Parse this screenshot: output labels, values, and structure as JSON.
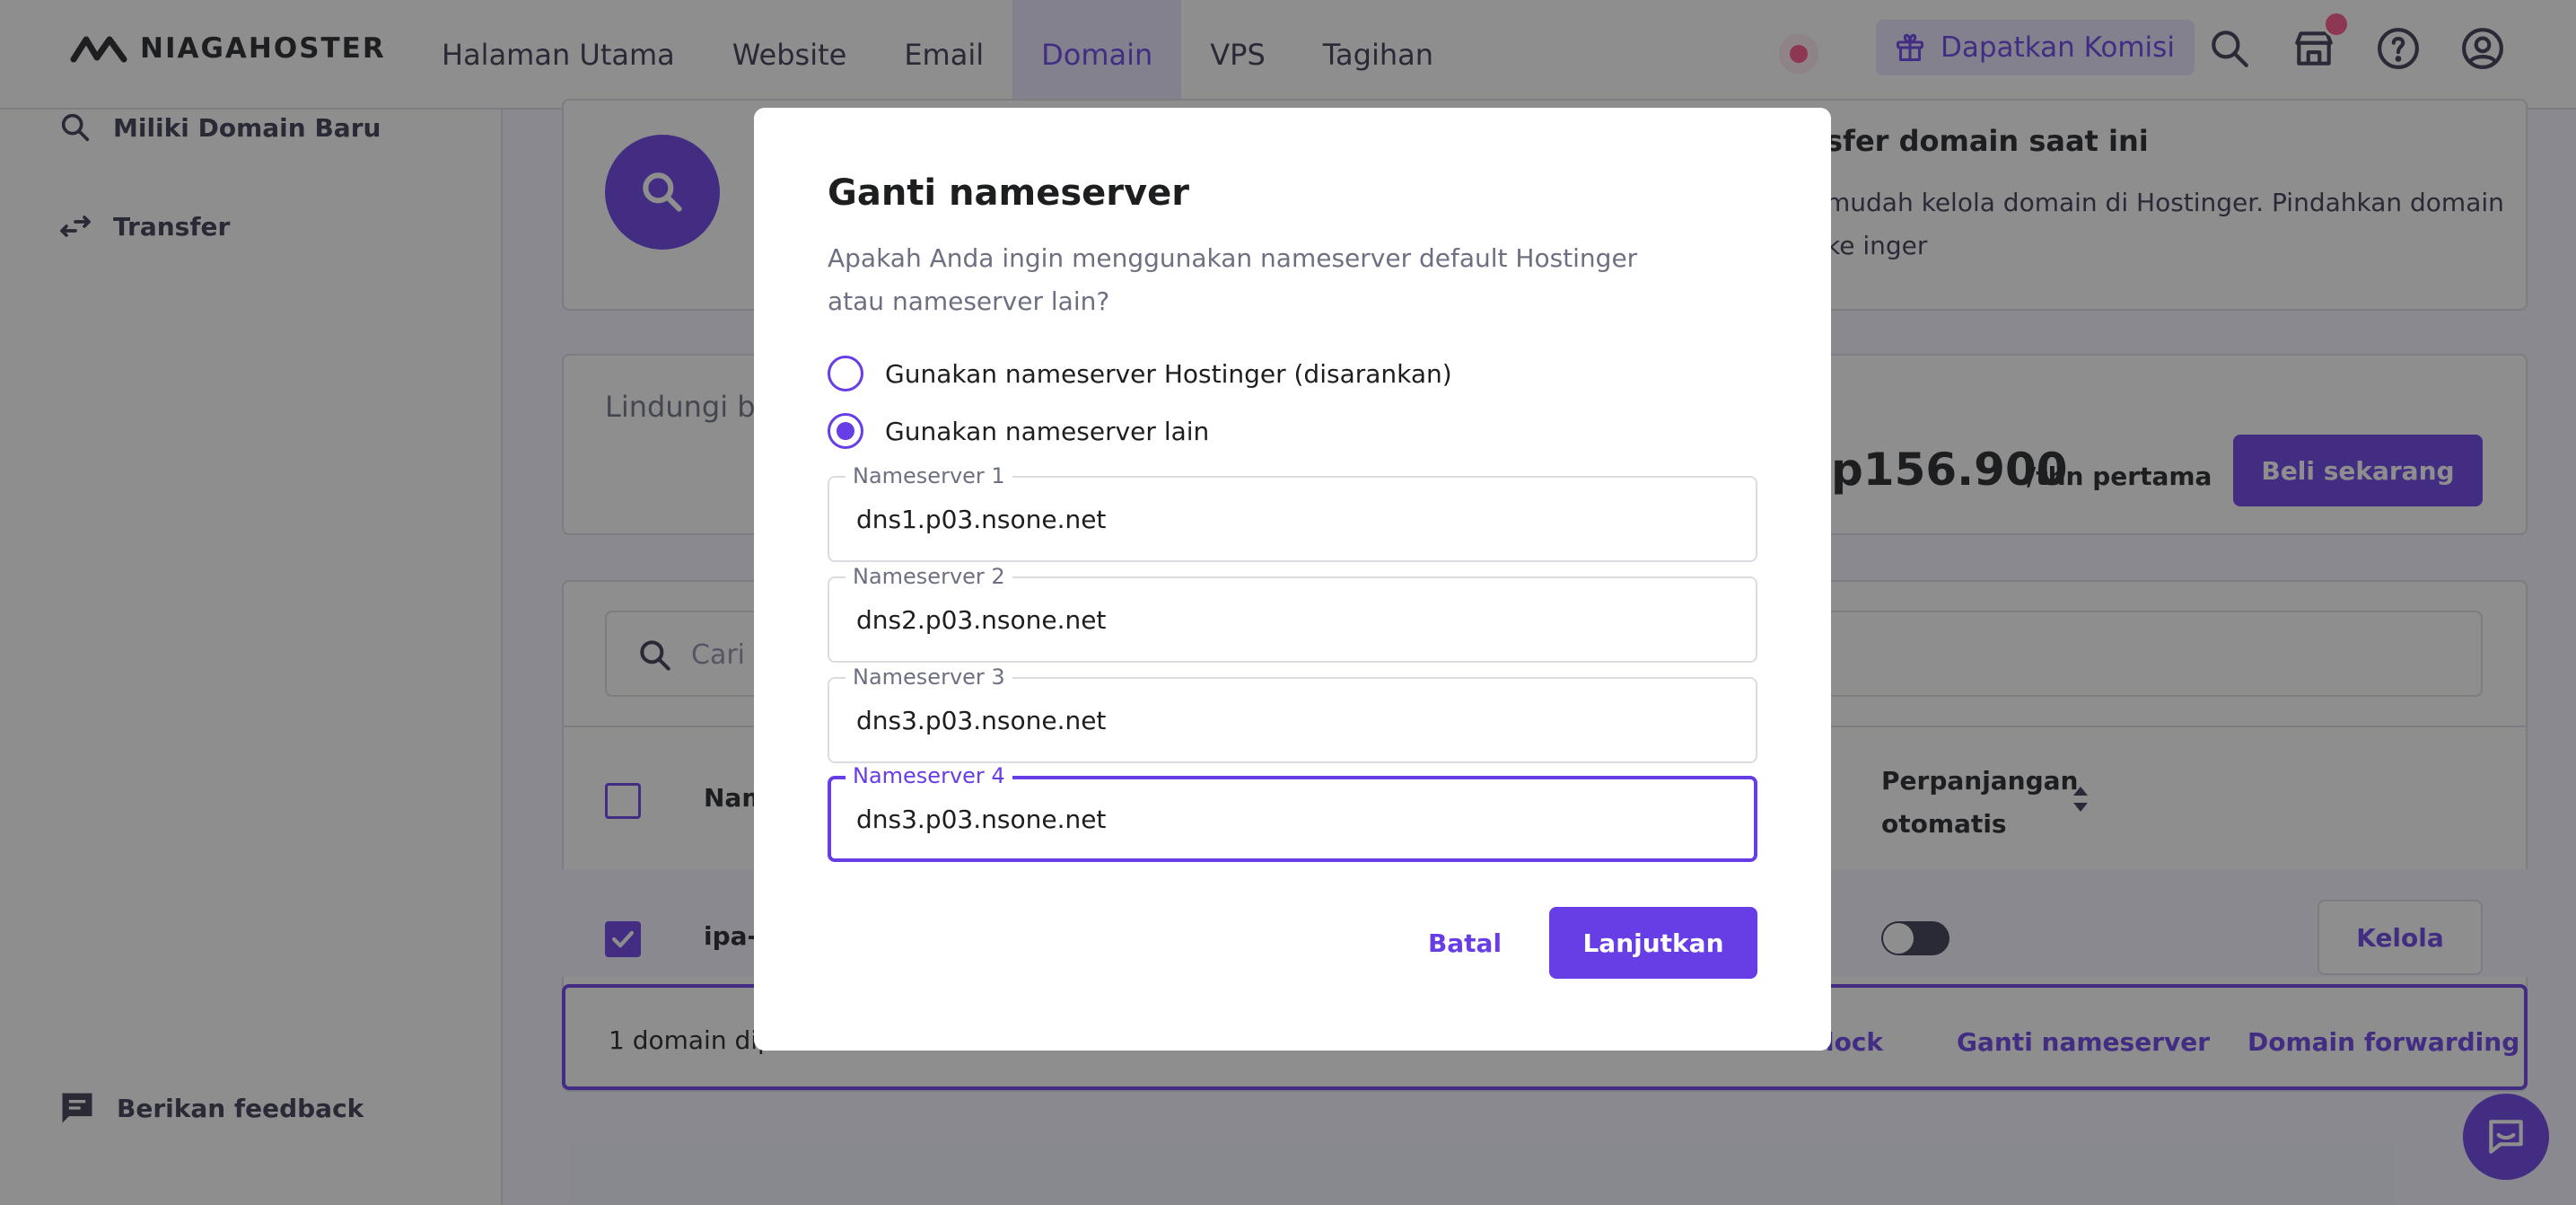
{
  "header": {
    "brand": "NIAGAHOSTER",
    "nav": [
      {
        "label": "Halaman Utama"
      },
      {
        "label": "Website"
      },
      {
        "label": "Email"
      },
      {
        "label": "Domain",
        "active": true
      },
      {
        "label": "VPS"
      },
      {
        "label": "Tagihan"
      }
    ],
    "commission_label": "Dapatkan Komisi",
    "icons": [
      "search-icon",
      "store-icon",
      "help-icon",
      "account-icon"
    ]
  },
  "sidebar": {
    "items": [
      {
        "label": "Miliki Domain Baru",
        "icon": "search-icon"
      },
      {
        "label": "Transfer",
        "icon": "transfer-icon"
      }
    ],
    "feedback_label": "Berikan feedback"
  },
  "main": {
    "promo": {
      "title_visible": "sfer domain saat ini",
      "text_visible": "mudah kelola domain di Hostinger. Pindahkan domain ke inger"
    },
    "protect": {
      "text_visible": "Lindungi br",
      "price_visible": "p156.900",
      "price_suffix": "/thn pertama",
      "buy_label": "Beli sekarang"
    },
    "search_placeholder": "Cari",
    "table": {
      "col_name_visible": "Nam",
      "col_renew": "Perpanjangan otomatis",
      "row_domain_visible": "ipa-",
      "manage_label": "Kelola"
    },
    "action_bar": {
      "count_visible": "1 domain dipi",
      "links": [
        {
          "label": "lock"
        },
        {
          "label": "Ganti nameserver"
        },
        {
          "label": "Domain forwarding"
        }
      ]
    }
  },
  "modal": {
    "title": "Ganti nameserver",
    "description": "Apakah Anda ingin menggunakan nameserver default Hostinger atau nameserver lain?",
    "options": [
      {
        "label": "Gunakan nameserver Hostinger (disarankan)",
        "selected": false
      },
      {
        "label": "Gunakan nameserver lain",
        "selected": true
      }
    ],
    "nameservers": [
      {
        "label": "Nameserver 1",
        "value": "dns1.p03.nsone.net"
      },
      {
        "label": "Nameserver 2",
        "value": "dns2.p03.nsone.net"
      },
      {
        "label": "Nameserver 3",
        "value": "dns3.p03.nsone.net"
      },
      {
        "label": "Nameserver 4",
        "value": "dns3.p03.nsone.net",
        "focused": true
      }
    ],
    "cancel_label": "Batal",
    "continue_label": "Lanjutkan"
  },
  "colors": {
    "primary": "#673de6",
    "overlay": "#1d1e20",
    "notification": "#fc5185"
  }
}
